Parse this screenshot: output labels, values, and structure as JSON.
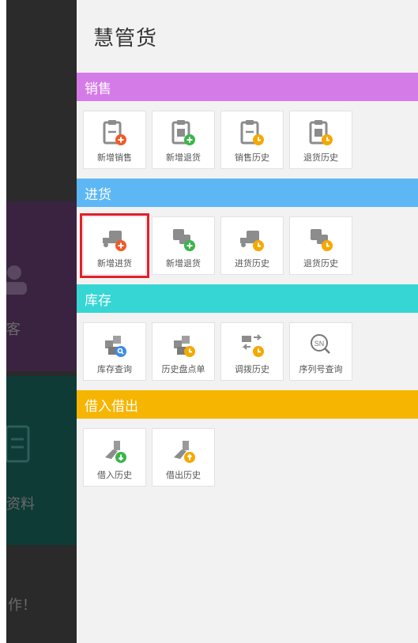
{
  "background_app": {
    "texts": [
      "客",
      "资料",
      "作！"
    ]
  },
  "drawer": {
    "title": "慧管货",
    "sections": [
      {
        "name": "销售",
        "color": "#d57be8",
        "items": [
          {
            "label": "新增销售",
            "icon": "receipt-add-icon",
            "badge_color": "#f05a28"
          },
          {
            "label": "新增退货",
            "icon": "receipt-return-add-icon",
            "badge_color": "#3bb54a"
          },
          {
            "label": "销售历史",
            "icon": "receipt-history-icon",
            "badge_color": "#f6a800"
          },
          {
            "label": "退货历史",
            "icon": "receipt-return-history-icon",
            "badge_color": "#f6a800"
          }
        ]
      },
      {
        "name": "进货",
        "color": "#5db7f5",
        "items": [
          {
            "label": "新增进货",
            "icon": "truck-add-icon",
            "badge_color": "#f05a28",
            "selected": true
          },
          {
            "label": "新增退货",
            "icon": "truck-return-add-icon",
            "badge_color": "#3bb54a"
          },
          {
            "label": "进货历史",
            "icon": "truck-history-icon",
            "badge_color": "#f6a800"
          },
          {
            "label": "退货历史",
            "icon": "truck-return-history-icon",
            "badge_color": "#f6a800"
          }
        ]
      },
      {
        "name": "库存",
        "color": "#36d6d4",
        "items": [
          {
            "label": "库存查询",
            "icon": "boxes-search-icon",
            "badge_color": "#3b8ee6"
          },
          {
            "label": "历史盘点单",
            "icon": "boxes-history-icon",
            "badge_color": "#f6a800"
          },
          {
            "label": "调拨历史",
            "icon": "transfer-history-icon",
            "badge_color": "#f6a800"
          },
          {
            "label": "序列号查询",
            "icon": "serial-number-search-icon",
            "badge_color": "#888888"
          }
        ]
      },
      {
        "name": "借入借出",
        "color": "#f6b500",
        "items": [
          {
            "label": "借入历史",
            "icon": "borrow-in-history-icon",
            "badge_color": "#3bb54a"
          },
          {
            "label": "借出历史",
            "icon": "borrow-out-history-icon",
            "badge_color": "#f6a800"
          }
        ]
      }
    ]
  }
}
